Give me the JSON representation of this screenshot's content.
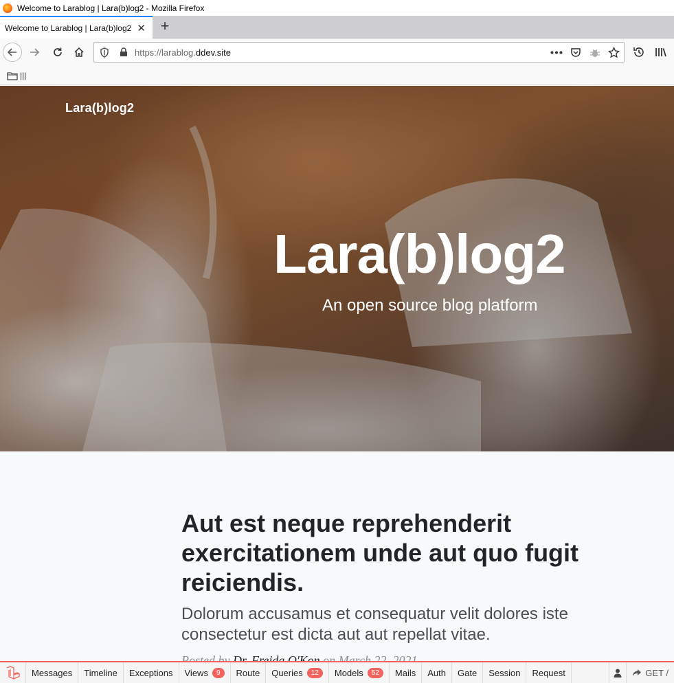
{
  "window": {
    "title": "Welcome to Larablog | Lara(b)log2 - Mozilla Firefox"
  },
  "tab": {
    "label": "Welcome to Larablog | Lara(b)log2",
    "close": "✕",
    "new": "+"
  },
  "url": {
    "prefix": "https://larablog.",
    "domain": "ddev.site"
  },
  "bookmarks": {
    "folder": "|||"
  },
  "hero": {
    "brand": "Lara(b)log2",
    "title": "Lara(b)log2",
    "subtitle": "An open source blog platform"
  },
  "post": {
    "title": "Aut est neque reprehenderit exercitationem unde aut quo fugit reiciendis.",
    "subtitle": "Dolorum accusamus et consequatur velit dolores iste consectetur est dicta aut aut repellat vitae.",
    "meta_prefix": "Posted by ",
    "author": "Dr. Freida O'Kon",
    "meta_suffix": " on March 22, 2021"
  },
  "debugbar": {
    "items": [
      {
        "label": "Messages"
      },
      {
        "label": "Timeline"
      },
      {
        "label": "Exceptions"
      },
      {
        "label": "Views",
        "badge": "9"
      },
      {
        "label": "Route"
      },
      {
        "label": "Queries",
        "badge": "12"
      },
      {
        "label": "Models",
        "badge": "52"
      },
      {
        "label": "Mails"
      },
      {
        "label": "Auth"
      },
      {
        "label": "Gate"
      },
      {
        "label": "Session"
      },
      {
        "label": "Request"
      }
    ],
    "method": "GET /",
    "accent": "#f4645f"
  }
}
